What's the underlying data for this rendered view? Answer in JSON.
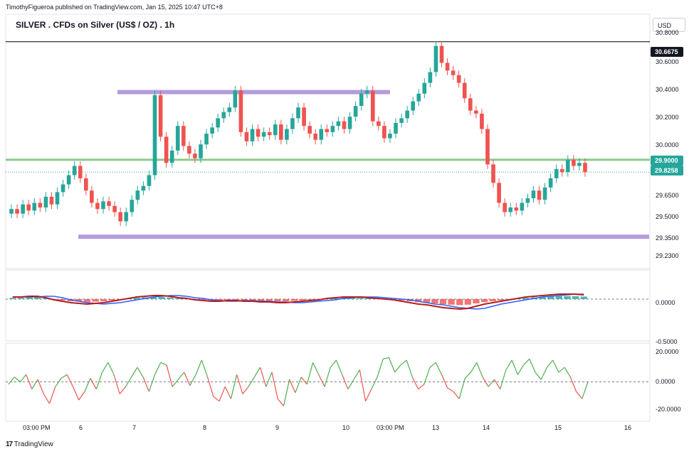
{
  "header": {
    "publisher": "TimothyFigueroa published on TradingView.com, Jan 15, 2025 10:47 UTC+8",
    "title": "SILVER . CFDs on Silver (US$ / OZ) . 1h",
    "currency": "USD"
  },
  "price_axis": {
    "labels": [
      "30.8000",
      "30.6000",
      "30.4000",
      "30.2000",
      "30.0000",
      "29.6500",
      "29.5000",
      "29.3500",
      "29.2300"
    ],
    "tags": {
      "resistance": "30.6675",
      "zone": "29.9000",
      "last": "29.8258"
    }
  },
  "macd_axis": {
    "labels": [
      "0.0000",
      "-0.5000"
    ]
  },
  "osc_axis": {
    "labels": [
      "20.0000",
      "0.0000",
      "-20.0000"
    ]
  },
  "time_axis": {
    "labels": [
      "03:00 PM",
      "6",
      "7",
      "8",
      "9",
      "10",
      "03:00 PM",
      "13",
      "14",
      "15",
      "16"
    ]
  },
  "footer": {
    "brand": "TradingView"
  },
  "colors": {
    "up": "#26a69a",
    "down": "#ef5350",
    "zone": "#b39ddb",
    "resistance_line": "#000000",
    "support_line": "#4caf50"
  },
  "chart_data": [
    {
      "type": "candlestick",
      "series": [
        {
          "name": "SILVER",
          "close": [
            29.58,
            29.55,
            29.61,
            29.57,
            29.62,
            29.59,
            29.66,
            29.61,
            29.69,
            29.74,
            29.8,
            29.86,
            29.78,
            29.7,
            29.62,
            29.58,
            29.63,
            29.6,
            29.56,
            29.5,
            29.56,
            29.64,
            29.7,
            29.73,
            29.8,
            30.32,
            30.05,
            29.88,
            29.96,
            30.12,
            29.99,
            29.94,
            29.91,
            30.0,
            30.07,
            30.11,
            30.17,
            30.21,
            30.24,
            30.35,
            30.08,
            30.02,
            30.1,
            30.05,
            30.08,
            30.06,
            30.13,
            30.03,
            30.1,
            30.17,
            30.24,
            30.12,
            30.07,
            30.03,
            30.1,
            30.08,
            30.12,
            30.15,
            30.1,
            30.18,
            30.25,
            30.33,
            30.35,
            30.15,
            30.12,
            30.04,
            30.07,
            30.14,
            30.17,
            30.22,
            30.28,
            30.33,
            30.4,
            30.47,
            30.64,
            30.53,
            30.48,
            30.45,
            30.4,
            30.3,
            30.22,
            30.2,
            30.1,
            29.87,
            29.75,
            29.62,
            29.56,
            29.59,
            29.57,
            29.62,
            29.65,
            29.7,
            29.64,
            29.72,
            29.78,
            29.84,
            29.82,
            29.9,
            29.86,
            29.88,
            29.82
          ]
        }
      ],
      "horizontal_levels": [
        {
          "value": 30.6675,
          "kind": "line"
        },
        {
          "value": 29.9,
          "kind": "line"
        },
        {
          "value": 30.34,
          "kind": "zone"
        },
        {
          "value": 29.4,
          "kind": "zone"
        }
      ],
      "ylim": [
        29.23,
        30.8
      ]
    },
    {
      "type": "histogram+line",
      "values": [
        0.03,
        0.03,
        0.04,
        0.04,
        0.02,
        -0.01,
        -0.03,
        -0.05,
        -0.06,
        -0.07,
        -0.06,
        -0.05,
        -0.03,
        -0.01,
        0.01,
        0.03,
        0.04,
        0.05,
        0.05,
        0.04,
        0.02,
        0.01,
        -0.01,
        -0.02,
        -0.03,
        -0.03,
        -0.02,
        -0.02,
        -0.03,
        -0.03,
        -0.04,
        -0.04,
        -0.05,
        -0.05,
        -0.04,
        -0.03,
        -0.02,
        -0.01,
        0.01,
        0.02,
        0.03,
        0.03,
        0.03,
        0.02,
        0.01,
        0.0,
        -0.01,
        -0.03,
        -0.05,
        -0.07,
        -0.08,
        -0.1,
        -0.12,
        -0.13,
        -0.14,
        -0.13,
        -0.1,
        -0.07,
        -0.05,
        -0.03,
        -0.01,
        0.01,
        0.03,
        0.04,
        0.05,
        0.06,
        0.07,
        0.07,
        0.07,
        0.06
      ],
      "ylim": [
        -0.55,
        0.35
      ]
    },
    {
      "type": "line",
      "values": [
        -2,
        4,
        0,
        6,
        -6,
        2,
        -10,
        -18,
        -4,
        3,
        6,
        -4,
        -15,
        -8,
        3,
        -6,
        8,
        16,
        6,
        -10,
        -4,
        4,
        12,
        4,
        -8,
        6,
        16,
        14,
        -4,
        2,
        8,
        -3,
        6,
        18,
        4,
        -12,
        -16,
        -4,
        -14,
        6,
        -10,
        -4,
        4,
        12,
        -4,
        8,
        -14,
        -20,
        2,
        -9,
        4,
        -2,
        16,
        6,
        -4,
        12,
        18,
        6,
        -6,
        2,
        10,
        -16,
        -6,
        4,
        19,
        20,
        8,
        14,
        18,
        4,
        -6,
        -2,
        12,
        16,
        6,
        -5,
        -8,
        -14,
        3,
        8,
        16,
        4,
        -4,
        2,
        -6,
        10,
        18,
        6,
        14,
        19,
        8,
        2,
        12,
        18,
        8,
        12,
        4,
        -8,
        -14,
        0
      ],
      "ylim": [
        -25,
        25
      ]
    }
  ]
}
